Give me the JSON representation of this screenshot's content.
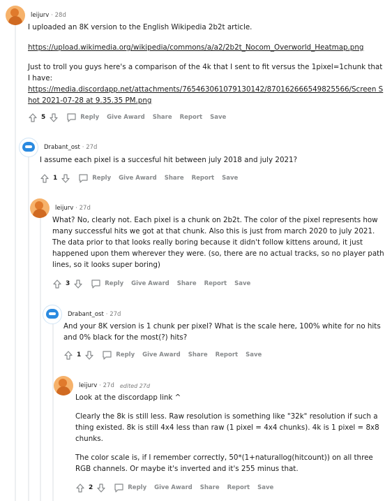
{
  "comments": [
    {
      "username": "leijurv",
      "time": "28d",
      "paragraphs": [
        "I uploaded an 8K version to the English Wikipedia 2b2t article."
      ],
      "link1": "https://upload.wikimedia.org/wikipedia/commons/a/a2/2b2t_Nocom_Overworld_Heatmap.png",
      "text2": "Just to troll you guys here's a comparison of the 4k that I sent to fit versus the 1pixel=1chunk that I have:",
      "link2": "https://media.discordapp.net/attachments/765463061079130142/870162666549825566/Screen Shot 2021-07-28 at 9.35.35 PM.png",
      "votes": "5"
    },
    {
      "username": "Drabant_ost",
      "time": "27d",
      "text": "I assume each pixel is a succesful hit between july 2018 and july 2021?",
      "votes": "1"
    },
    {
      "username": "leijurv",
      "time": "27d",
      "text": "What? No, clearly not. Each pixel is a chunk on 2b2t. The color of the pixel represents how many successful hits we got at that chunk. Also this is just from march 2020 to july 2021. The data prior to that looks really boring because it didn't follow kittens around, it just happened upon them wherever they were. (so, there are no actual tracks, so no player path lines, so it looks super boring)",
      "votes": "3"
    },
    {
      "username": "Drabant_ost",
      "time": "27d",
      "text": "And your 8K version is 1 chunk per pixel? What is the scale here, 100% white for no hits and 0% black for the most(?) hits?",
      "votes": "1"
    },
    {
      "username": "leijurv",
      "time": "27d",
      "edited": "edited 27d",
      "paragraphs": [
        "Look at the discordapp link ^",
        "Clearly the 8k is still less. Raw resolution is something like \"32k\" resolution if such a thing existed. 8k is still 4x4 less than raw (1 pixel = 4x4 chunks). 4k is 1 pixel = 8x8 chunks.",
        "The color scale is, if I remember correctly, 50*(1+naturallog(hitcount)) on all three RGB channels. Or maybe it's inverted and it's 255 minus that."
      ],
      "votes": "2"
    }
  ],
  "actions": {
    "reply": "Reply",
    "give_award": "Give Award",
    "share": "Share",
    "report": "Report",
    "save": "Save"
  },
  "icons": {
    "upvote": "upvote-arrow-icon",
    "downvote": "downvote-arrow-icon",
    "reply": "speech-bubble-icon"
  },
  "colors": {
    "muted": "#878a8c",
    "thread_line": "#edeff1",
    "text": "#1c1c1c"
  }
}
